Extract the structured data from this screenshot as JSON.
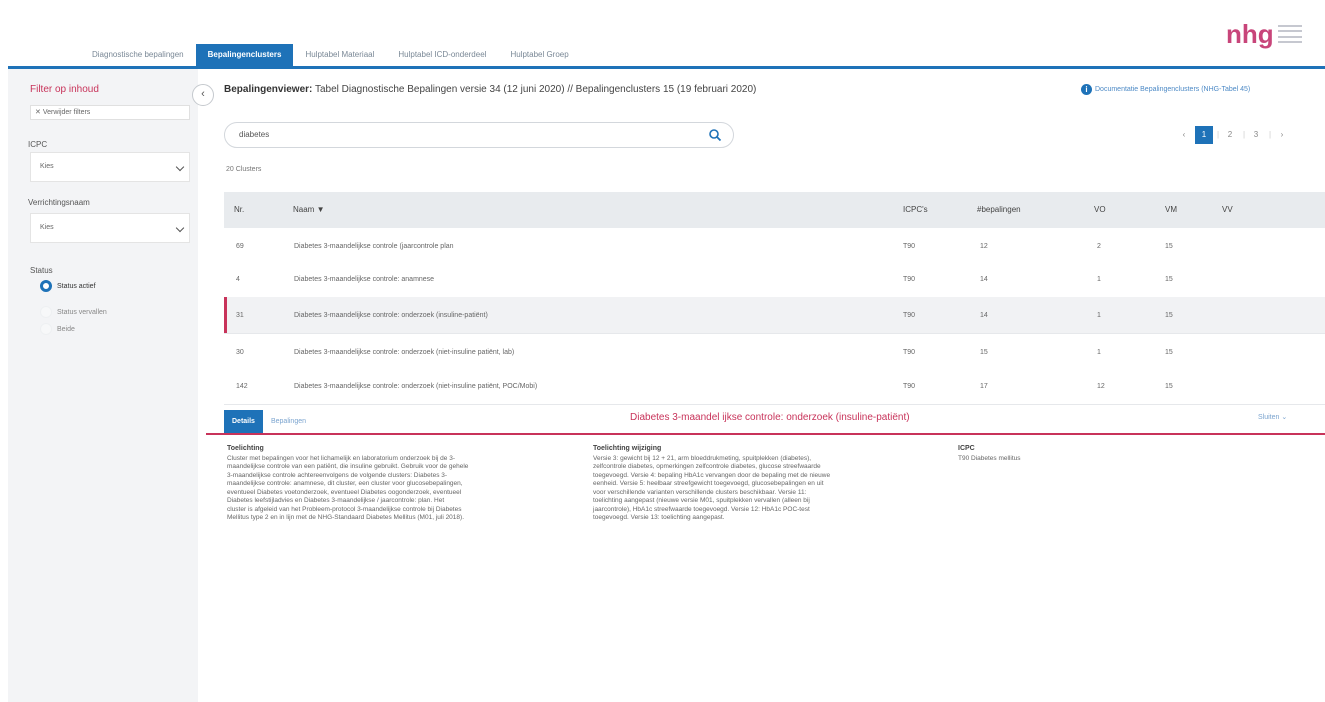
{
  "brand": {
    "logo_text": "nhg",
    "accent": "#1e72b8",
    "highlight": "#c8335a"
  },
  "tabs": [
    {
      "label": "Diagnostische bepalingen",
      "active": false
    },
    {
      "label": "Bepalingenclusters",
      "active": true
    },
    {
      "label": "Hulptabel Materiaal",
      "active": false
    },
    {
      "label": "Hulptabel ICD-onderdeel",
      "active": false
    },
    {
      "label": "Hulptabel Groep",
      "active": false
    }
  ],
  "sidebar": {
    "title": "Filter op inhoud",
    "clear_filters": "Verwijder filters",
    "icpc_label": "ICPC",
    "icpc_value": "Kies",
    "verrichting_label": "Verrichtingsnaam",
    "verrichting_value": "Kies",
    "status_label": "Status",
    "status_options": [
      {
        "label": "Status actief",
        "selected": true
      },
      {
        "label": "Status vervallen",
        "selected": false
      },
      {
        "label": "Beide",
        "selected": false
      }
    ]
  },
  "main": {
    "title_bold": "Bepalingenviewer:",
    "title_rest": " Tabel Diagnostische Bepalingen versie 34 (12 juni 2020) // Bepalingenclusters 15 (19 februari 2020)",
    "doc_link": "Documentatie Bepalingenclusters (NHG-Tabel 45)",
    "search_value": "diabetes",
    "result_count": "20 Clusters",
    "pagination": [
      "1",
      "2",
      "3"
    ]
  },
  "table": {
    "headers": {
      "nr": "Nr.",
      "naam": "Naam ▼",
      "icpc": "ICPC's",
      "bepalingen": "#bepalingen",
      "vo": "VO",
      "vm": "VM",
      "vv": "VV"
    },
    "rows": [
      {
        "nr": "69",
        "naam": "Diabetes 3-maandelijkse controle (jaarcontrole plan",
        "icpc": "T90",
        "bepalingen": "12",
        "vo": "2",
        "vm": "15",
        "vv": ""
      },
      {
        "nr": "4",
        "naam": "Diabetes 3-maandelijkse controle: anamnese",
        "icpc": "T90",
        "bepalingen": "14",
        "vo": "1",
        "vm": "15",
        "vv": ""
      },
      {
        "nr": "31",
        "naam": "Diabetes 3-maandelijkse controle: onderzoek (insuline-patiënt)",
        "icpc": "T90",
        "bepalingen": "14",
        "vo": "1",
        "vm": "15",
        "vv": ""
      },
      {
        "nr": "30",
        "naam": "Diabetes 3-maandelijkse controle: onderzoek (niet-insuline patiënt, lab)",
        "icpc": "T90",
        "bepalingen": "15",
        "vo": "1",
        "vm": "15",
        "vv": ""
      },
      {
        "nr": "142",
        "naam": "Diabetes 3-maandelijkse controle: onderzoek (niet-insuline patiënt, POC/Mobi)",
        "icpc": "T90",
        "bepalingen": "17",
        "vo": "12",
        "vm": "15",
        "vv": ""
      }
    ]
  },
  "detail": {
    "tabs": [
      {
        "label": "Details",
        "active": true
      },
      {
        "label": "Bepalingen",
        "active": false
      }
    ],
    "title": "Diabetes 3-maandel ijkse controle: onderzoek (insuline-patiënt)",
    "close_label": "Sluiten",
    "toelichting_header": "Toelichting",
    "toelichting_lines": [
      "Cluster met bepalingen voor het lichamelijk en laboratorium onderzoek bij de 3-",
      "maandelijkse controle van een patiënt, die insuline gebruikt. Gebruik voor de gehele",
      "3-maandelijkse controle achtereenvolgens de volgende clusters: Diabetes 3-",
      "maandelijkse controle: anamnese, dit cluster, een cluster voor glucosebepalingen,",
      "eventueel Diabetes voetonderzoek, eventueel Diabetes oogonderzoek, eventueel",
      "Diabetes leefstijladvies en Diabetes 3-maandelijkse / jaarcontrole: plan. Het",
      "cluster is afgeleid van het Probleem-protocol 3-maandelijkse controle bij Diabetes",
      "Mellitus type 2 en in lijn met de NHG-Standaard Diabetes Mellitus (M01, juli 2018)."
    ],
    "wijziging_header": "Toelichting wijziging",
    "wijziging_lines": [
      "Versie 3: gewicht bij 12 + 21, arm bloeddrukmeting, spuitplekken (diabetes),",
      "zelfcontrole diabetes, opmerkingen zelfcontrole diabetes, glucose streefwaarde",
      "toegevoegd. Versie 4: bepaling HbA1c vervangen door de bepaling met de nieuwe",
      "eenheid. Versie 5: heelbaar streefgewicht toegevoegd, glucosebepalingen en uit",
      "voor verschillende varianten verschillende clusters beschikbaar. Versie 11:",
      "toelichting aangepast (nieuwe versie M01, spuitplekken vervallen (alleen bij",
      "jaarcontrole), HbA1c streefwaarde toegevoegd. Versie 12: HbA1c POC-test",
      "toegevoegd. Versie 13: toelichting aangepast."
    ],
    "icpc_header": "ICPC",
    "icpc_value": "T90 Diabetes mellitus"
  }
}
